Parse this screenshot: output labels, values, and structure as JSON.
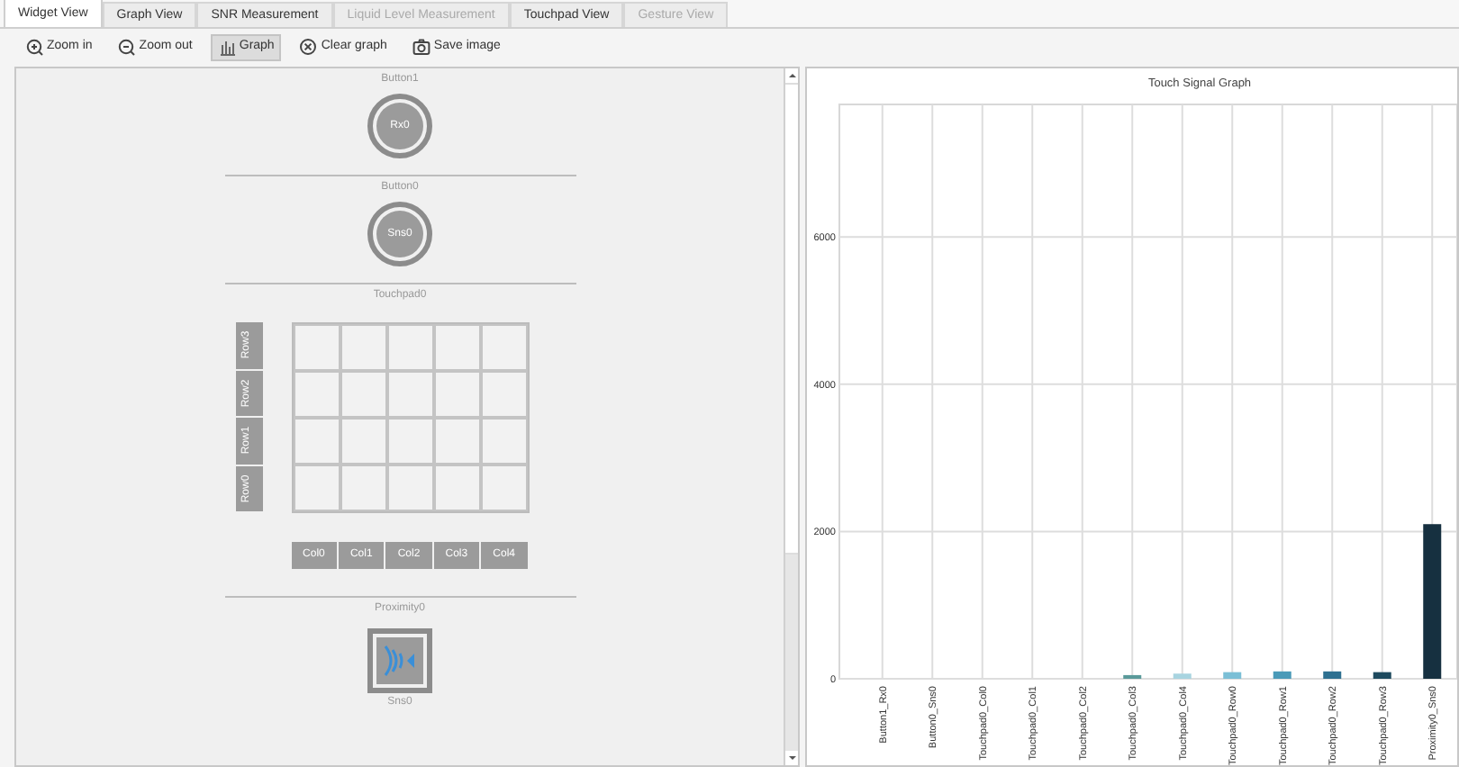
{
  "tabs": [
    {
      "label": "Widget View",
      "selected": true,
      "disabled": false
    },
    {
      "label": "Graph View",
      "selected": false,
      "disabled": false
    },
    {
      "label": "SNR Measurement",
      "selected": false,
      "disabled": false
    },
    {
      "label": "Liquid Level Measurement",
      "selected": false,
      "disabled": true
    },
    {
      "label": "Touchpad View",
      "selected": false,
      "disabled": false
    },
    {
      "label": "Gesture View",
      "selected": false,
      "disabled": true
    }
  ],
  "toolbar": [
    {
      "kind": "zoom-in",
      "label": "Zoom in",
      "pressed": false
    },
    {
      "kind": "zoom-out",
      "label": "Zoom out",
      "pressed": false
    },
    {
      "kind": "graph",
      "label": "Graph",
      "pressed": true
    },
    {
      "kind": "clear",
      "label": "Clear graph",
      "pressed": false
    },
    {
      "kind": "camera",
      "label": "Save image",
      "pressed": false
    }
  ],
  "widgets": [
    {
      "kind": "button",
      "title": "Button1",
      "sensor": "Rx0"
    },
    {
      "kind": "button",
      "title": "Button0",
      "sensor": "Sns0"
    },
    {
      "kind": "touchpad",
      "title": "Touchpad0",
      "rows": [
        "Row3",
        "Row2",
        "Row1",
        "Row0"
      ],
      "columns": [
        "Col0",
        "Col1",
        "Col2",
        "Col3",
        "Col4"
      ]
    },
    {
      "kind": "proximity",
      "title": "Proximity0",
      "sensor": "Sns0"
    }
  ],
  "graph": {
    "chart_data": {
      "type": "bar",
      "title": "Touch Signal Graph",
      "categories": [
        "Button1_Rx0",
        "Button0_Sns0",
        "Touchpad0_Col0",
        "Touchpad0_Col1",
        "Touchpad0_Col2",
        "Touchpad0_Col3",
        "Touchpad0_Col4",
        "Touchpad0_Row0",
        "Touchpad0_Row1",
        "Touchpad0_Row2",
        "Touchpad0_Row3",
        "Proximity0_Sns0"
      ],
      "values": [
        0,
        0,
        0,
        0,
        0,
        50,
        70,
        90,
        100,
        100,
        90,
        2100
      ],
      "colors": [
        null,
        null,
        null,
        null,
        null,
        "#5a9a9a",
        "#a8d4e0",
        "#7bbfd6",
        "#4a9ab8",
        "#2e7090",
        "#1e4a5e",
        "#163040"
      ],
      "grid": true,
      "ylim": [
        0,
        7800
      ],
      "yticks": [
        0,
        2000,
        4000,
        6000
      ]
    }
  }
}
